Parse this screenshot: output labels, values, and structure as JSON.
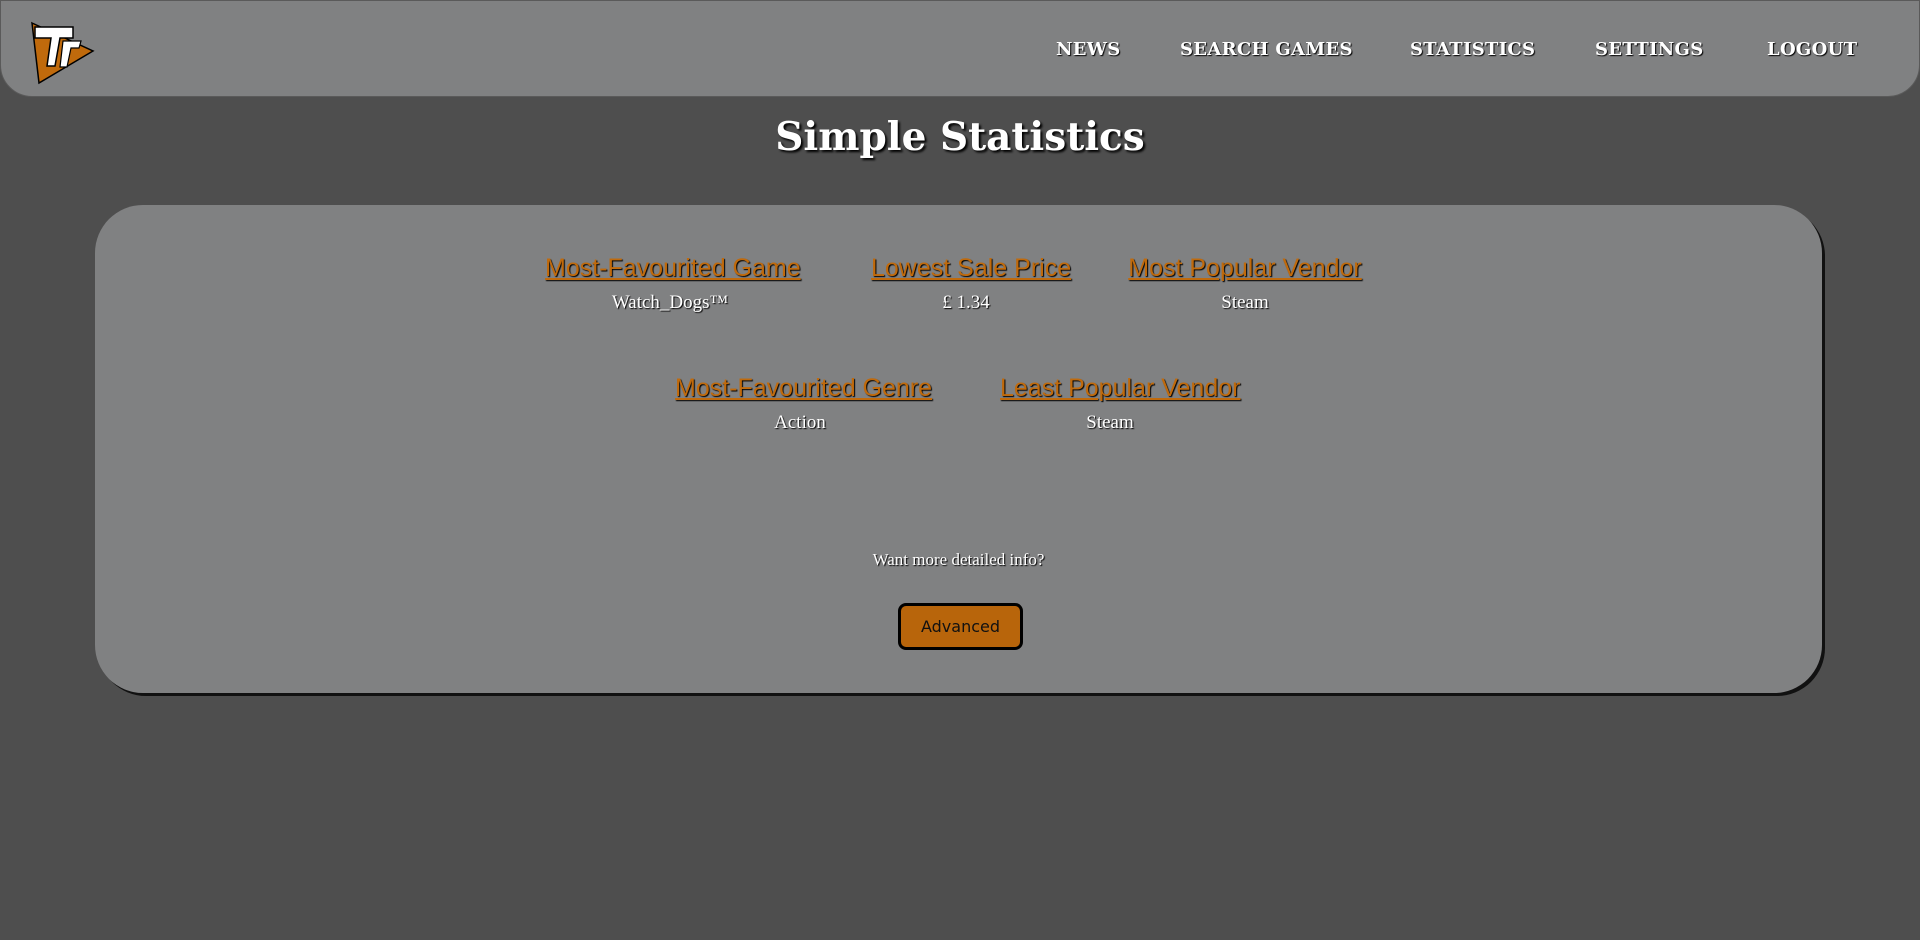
{
  "header": {
    "logo_icon": "tf-logo-icon",
    "nav": {
      "news": "NEWS",
      "search_games": "SEARCH GAMES",
      "statistics": "STATISTICS",
      "settings": "SETTINGS",
      "logout": "LOGOUT"
    }
  },
  "main": {
    "title": "Simple Statistics",
    "stats": [
      {
        "label": "Most-Favourited Game",
        "value": "Watch_Dogs™"
      },
      {
        "label": "Lowest Sale Price",
        "value": "£ 1.34"
      },
      {
        "label": "Most Popular Vendor",
        "value": "Steam"
      },
      {
        "label": "Most-Favourited Genre",
        "value": "Action"
      },
      {
        "label": "Least Popular Vendor",
        "value": "Steam"
      }
    ],
    "more_info_text": "Want more detailed info?",
    "advanced_button": "Advanced"
  },
  "colors": {
    "background": "#4e4e4e",
    "panel": "#808182",
    "accent": "#c06a0c",
    "button": "#b8650b"
  }
}
